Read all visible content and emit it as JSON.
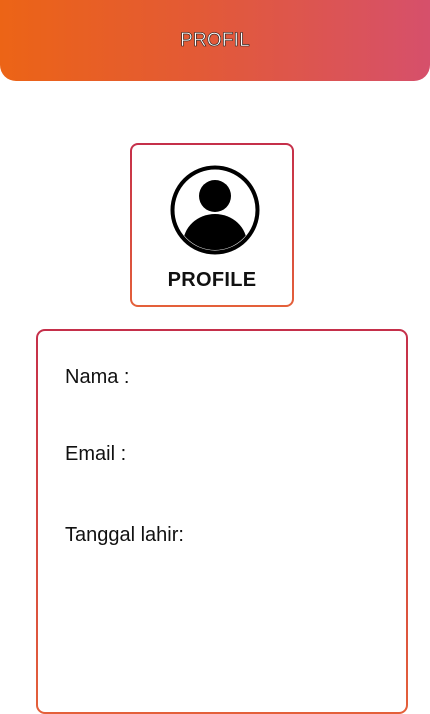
{
  "header": {
    "title": "PROFIL",
    "gradient_start": "#ec6416",
    "gradient_end": "#d6506b"
  },
  "avatar": {
    "icon": "user-circle-icon",
    "label": "PROFILE",
    "border_color": "#d14446"
  },
  "info": {
    "name_label": "Nama :",
    "email_label": "Email :",
    "dob_label": "Tanggal lahir:",
    "border_color": "#d14446"
  }
}
